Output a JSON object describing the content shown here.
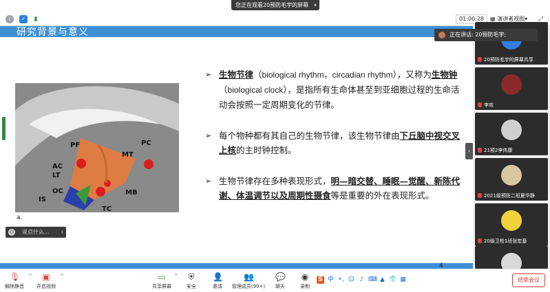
{
  "window": {
    "sharing_banner": "您正在观看20预防毛宇的屏幕",
    "pause_label": "⏸"
  },
  "status": {
    "timer": "01:00:28",
    "view_mode": "演讲者视图",
    "view_caret": "▾"
  },
  "slide": {
    "title": "研究背景与意义",
    "page_number": "4",
    "figure_label": "a.",
    "brain_labels": [
      "PF",
      "MT",
      "PC",
      "AC",
      "LT",
      "OC",
      "IS",
      "MB",
      "TC"
    ],
    "bullets": [
      {
        "parts": [
          {
            "text": "生物节律",
            "style": "bu"
          },
          {
            "text": "（",
            "style": ""
          },
          {
            "text": "biological rhythm，circadian rhythm",
            "style": "en"
          },
          {
            "text": "），又称为",
            "style": ""
          },
          {
            "text": "生物钟",
            "style": "bu"
          },
          {
            "text": "（",
            "style": ""
          },
          {
            "text": "biological clock",
            "style": "en"
          },
          {
            "text": "），是指所有生命体甚至到亚细胞过程的生命活动会按照一定周期变化的节律。",
            "style": ""
          }
        ]
      },
      {
        "parts": [
          {
            "text": "每个物种都有其自己的生物节律，该生物节律由",
            "style": ""
          },
          {
            "text": "下丘脑中视交叉上核",
            "style": "bu"
          },
          {
            "text": "的主时钟控制。",
            "style": ""
          }
        ]
      },
      {
        "parts": [
          {
            "text": "生物节律存在多种表现形式，",
            "style": ""
          },
          {
            "text": "明—暗交替、睡眠—觉醒、新陈代谢、体温调节以及周期性摄食",
            "style": "bu"
          },
          {
            "text": "等是重要的外在表现形式。",
            "style": ""
          }
        ]
      }
    ]
  },
  "speaker": {
    "label": "正在讲话: 20预防毛宇;"
  },
  "participants": [
    {
      "name": "20预防毛宇的屏幕共享",
      "avatar_color": "#2f7fe6"
    },
    {
      "name": "李欢",
      "avatar_color": "#8a2a2a"
    },
    {
      "name": "21预2李伟康",
      "avatar_color": "#cfcfcf"
    },
    {
      "name": "2021级预防二班夏华静",
      "avatar_color": "#d9c7a2"
    },
    {
      "name": "20级卫检1班张宏基",
      "avatar_color": "#f2d23a"
    },
    {
      "name": "",
      "avatar_color": "#d8d8d8"
    }
  ],
  "chat_hint": {
    "placeholder": "说点什么...",
    "chevron": "‹"
  },
  "toolbar": {
    "mute": "解除静音",
    "video": "开启视频",
    "share": "共享屏幕",
    "security": "安全",
    "invite": "邀请",
    "members": "管理成员(99+)",
    "chat": "聊天",
    "record": "录制",
    "end": "结束会议"
  },
  "colors": {
    "slide_band": "#3d8fd4",
    "end_button": "#e03c3c",
    "speaking_bg": "#3a3a3a"
  }
}
